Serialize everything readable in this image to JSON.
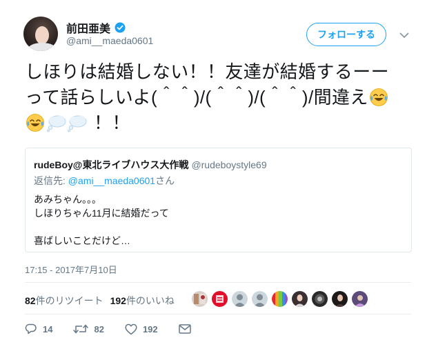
{
  "user": {
    "display_name": "前田亜美",
    "handle": "@ami__maeda0601",
    "verified_icon": "verified-badge-icon"
  },
  "follow_button": {
    "label": "フォローする"
  },
  "tweet": {
    "line1": "しほりは結婚しない！！友達が結婚するーー",
    "line2": "って話らしいよ(＾＾)/(＾＾)/(＾＾)/間違え",
    "line3_end": "！！",
    "emoji_names": [
      "face-with-tears-of-joy-icon",
      "face-with-tears-of-joy-icon",
      "thought-balloon-icon",
      "thought-balloon-icon"
    ]
  },
  "quote": {
    "name": "rudeBoy@東北ライブハウス大作戦",
    "handle": "@rudeboystyle69",
    "reply_prefix": "返信先: ",
    "reply_handle": "@ami__maeda0601",
    "reply_suffix": "さん",
    "lines": [
      "あみちゃん。。。",
      "しほりちゃん11月に結婚だって",
      "",
      "喜ばしいことだけど…"
    ]
  },
  "timestamp": "17:15 - 2017年7月10日",
  "stats": {
    "retweet_count": "82",
    "retweet_label": "件のリツイート",
    "like_count": "192",
    "like_label": "件のいいね"
  },
  "likers": [
    "liker-1",
    "liker-2",
    "liker-3",
    "liker-4",
    "liker-5",
    "liker-6",
    "liker-7",
    "liker-8",
    "liker-9"
  ],
  "actions": {
    "reply_count": "14",
    "retweet_count": "82",
    "like_count": "192"
  },
  "colors": {
    "accent": "#1da1f2",
    "text": "#14171a",
    "muted": "#657786",
    "border": "#e1e8ed"
  }
}
